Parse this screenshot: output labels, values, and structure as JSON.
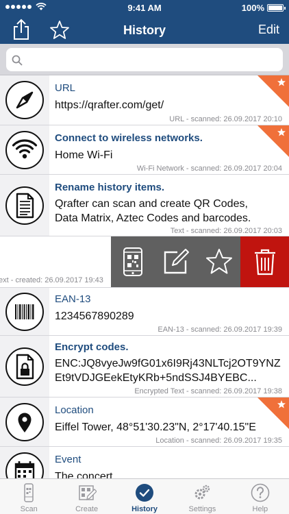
{
  "status": {
    "time": "9:41 AM",
    "battery": "100%"
  },
  "nav": {
    "title": "History",
    "edit_label": "Edit"
  },
  "search": {
    "placeholder": ""
  },
  "rows": [
    {
      "title": "URL",
      "content": "https://qrafter.com/get/",
      "meta": "URL - scanned: 26.09.2017 20:10",
      "starred": true
    },
    {
      "title": "Connect to wireless networks.",
      "content": "Home Wi-Fi",
      "meta": "Wi-Fi Network - scanned: 26.09.2017 20:04",
      "starred": true
    },
    {
      "title": "Rename history items.",
      "content": "Qrafter can scan and create QR Codes, Data Matrix, Aztec Codes and barcodes.",
      "meta": "Text - scanned: 26.09.2017 20:03",
      "starred": false
    },
    {
      "meta": "ext - created: 26.09.2017 19:43"
    },
    {
      "title": "EAN-13",
      "content": "1234567890289",
      "meta": "EAN-13 - scanned: 26.09.2017 19:39",
      "starred": false
    },
    {
      "title": "Encrypt codes.",
      "content": "ENC:JQ8vyeJw9fG01x6I9Rj43NLTcj2OT9YNZEt9tVDJGEekEtyKRb+5ndSSJ4BYEBC...",
      "meta": "Encrypted Text - scanned: 26.09.2017 19:38",
      "starred": false
    },
    {
      "title": "Location",
      "content": "Eiffel Tower, 48°51'30.23\"N, 2°17'40.15\"E",
      "meta": "Location - scanned: 26.09.2017 19:35",
      "starred": true
    },
    {
      "title": "Event",
      "content": "The concert"
    }
  ],
  "tabs": [
    {
      "label": "Scan"
    },
    {
      "label": "Create"
    },
    {
      "label": "History",
      "active": true
    },
    {
      "label": "Settings"
    },
    {
      "label": "Help"
    }
  ],
  "colors": {
    "nav": "#1f4c7e",
    "ribbon": "#f0703a",
    "delete": "#c0140f",
    "action": "#606060"
  }
}
